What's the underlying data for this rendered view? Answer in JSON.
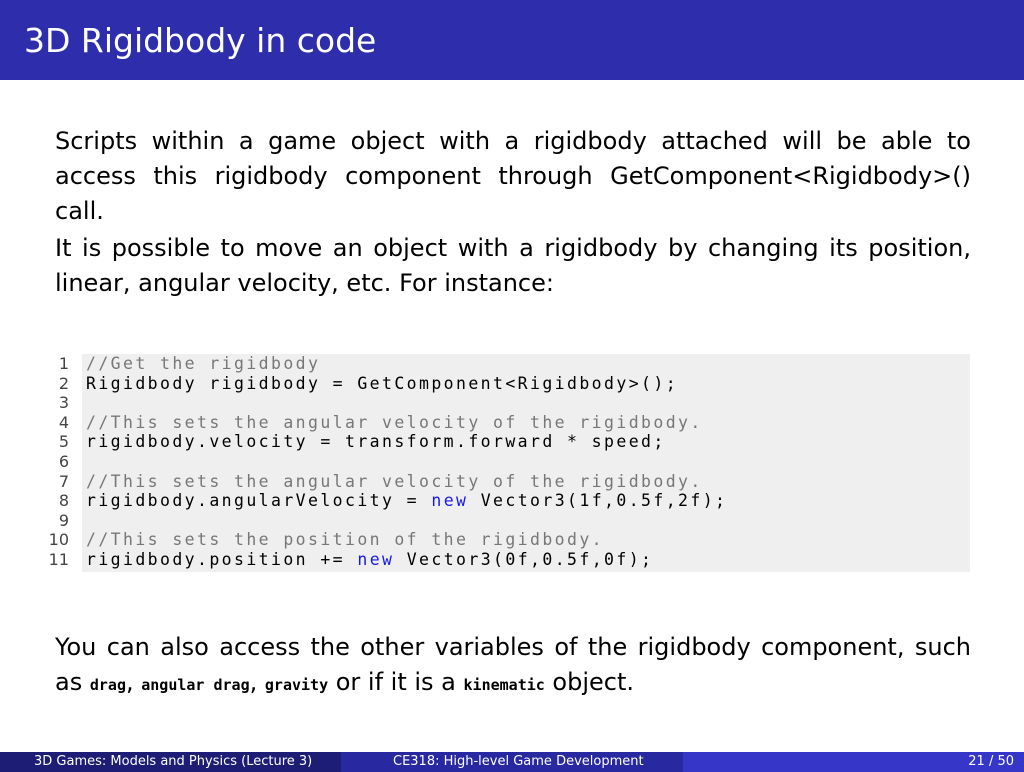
{
  "slide": {
    "title": "3D Rigidbody in code",
    "paragraph1": "Scripts within a game object with a rigidbody attached will be able to access this rigidbody component through GetComponent<Rigidbody>() call.",
    "paragraph2": "It is possible to move an object with a rigidbody by changing its position, linear, angular velocity, etc. For instance:",
    "paragraph3": {
      "lead": "You can also access the other variables of the rigidbody component, such as",
      "term_drag": "drag",
      "sep1": ", ",
      "term_angular_drag": "angular drag",
      "sep2": ", ",
      "term_gravity": "gravity",
      "mid": " or if it is a ",
      "term_kinematic": "kinematic",
      "tail": " object."
    }
  },
  "code": {
    "lines": [
      {
        "n": "1",
        "t": "//Get the rigidbody"
      },
      {
        "n": "2",
        "t": "Rigidbody rigidbody = GetComponent<Rigidbody>();"
      },
      {
        "n": "3",
        "t": ""
      },
      {
        "n": "4",
        "t": "//This sets the angular velocity of the rigidbody."
      },
      {
        "n": "5",
        "t": "rigidbody.velocity = transform.forward * speed;"
      },
      {
        "n": "6",
        "t": ""
      },
      {
        "n": "7",
        "t": "//This sets the angular velocity of the rigidbody."
      },
      {
        "n": "8",
        "a": "rigidbody.angularVelocity = ",
        "k": "new",
        "b": " Vector3(1f,0.5f,2f);"
      },
      {
        "n": "9",
        "t": ""
      },
      {
        "n": "10",
        "t": "//This sets the position of the rigidbody."
      },
      {
        "n": "11",
        "a": "rigidbody.position += ",
        "k": "new",
        "b": " Vector3(0f,0.5f,0f);"
      }
    ]
  },
  "footer": {
    "left": "3D Games: Models and Physics (Lecture 3)",
    "center": "CE318: High-level Game Development",
    "right": "21 / 50"
  },
  "colors": {
    "title_bar": "#2e2eac",
    "code_background": "#efefef",
    "keyword": "#1a1ae6",
    "comment": "#777777"
  }
}
